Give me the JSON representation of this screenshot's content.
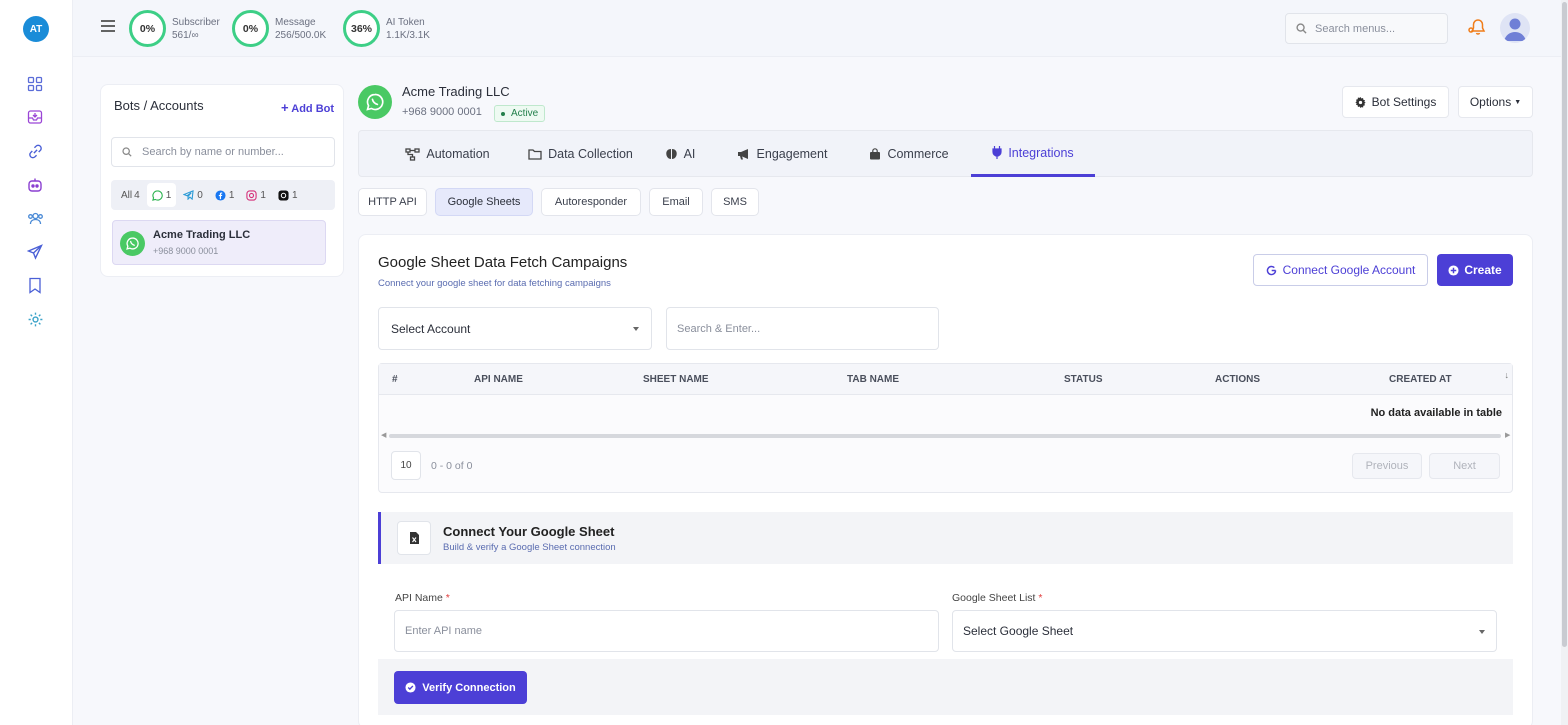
{
  "rail": {
    "logo": "AT",
    "icons": [
      "dashboard-icon",
      "inbox-icon",
      "integration-link-icon",
      "bot-icon",
      "contacts-icon",
      "broadcast-send-icon",
      "bookmark-icon",
      "settings-gear-icon"
    ]
  },
  "topbar": {
    "gauges": [
      {
        "percent": "0%",
        "label": "Subscriber",
        "value": "561/∞"
      },
      {
        "percent": "0%",
        "label": "Message",
        "value": "256/500.0K"
      },
      {
        "percent": "36%",
        "label": "AI Token",
        "value": "1.1K/3.1K"
      }
    ],
    "search_placeholder": "Search menus..."
  },
  "bots_panel": {
    "title": "Bots / Accounts",
    "add_bot": "Add Bot",
    "search_placeholder": "Search by name or number...",
    "filters": [
      {
        "label": "All",
        "count": "4"
      },
      {
        "icon": "whatsapp-icon",
        "count": "1"
      },
      {
        "icon": "telegram-icon",
        "count": "0"
      },
      {
        "icon": "facebook-icon",
        "count": "1"
      },
      {
        "icon": "instagram-icon",
        "count": "1"
      },
      {
        "icon": "threads-icon",
        "count": "1"
      }
    ],
    "items": [
      {
        "name": "Acme Trading LLC",
        "number": "+968 9000 0001"
      }
    ]
  },
  "bot_header": {
    "name": "Acme Trading LLC",
    "number": "+968 9000 0001",
    "status": "Active",
    "bot_settings": "Bot Settings",
    "options": "Options"
  },
  "tabs": [
    "Automation",
    "Data Collection",
    "AI",
    "Engagement",
    "Commerce",
    "Integrations"
  ],
  "active_tab": "Integrations",
  "subtabs": [
    "HTTP API",
    "Google Sheets",
    "Autoresponder",
    "Email",
    "SMS"
  ],
  "active_subtab": "Google Sheets",
  "card": {
    "title": "Google Sheet Data Fetch Campaigns",
    "subtitle": "Connect your google sheet for data fetching campaigns",
    "connect_btn": "Connect Google Account",
    "create_btn": "Create",
    "select_account": "Select Account",
    "search_placeholder": "Search & Enter...",
    "table": {
      "columns": [
        "#",
        "API NAME",
        "SHEET NAME",
        "TAB NAME",
        "STATUS",
        "ACTIONS",
        "CREATED AT"
      ],
      "empty": "No data available in table",
      "page_size": "10",
      "info": "0 - 0 of 0",
      "prev": "Previous",
      "next": "Next"
    }
  },
  "connect_section": {
    "title": "Connect Your Google Sheet",
    "subtitle": "Build & verify a Google Sheet connection",
    "api_name_label": "API Name",
    "api_name_placeholder": "Enter API name",
    "sheet_list_label": "Google Sheet List",
    "sheet_select": "Select Google Sheet",
    "verify_btn": "Verify Connection",
    "required_mark": "*"
  },
  "colors": {
    "accent": "#4c3fd6",
    "whatsapp": "#4ac964",
    "gauge": "#3dcf86"
  }
}
